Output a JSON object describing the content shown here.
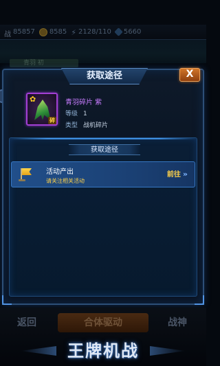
{
  "hud": {
    "power_value": "85857",
    "gold_value": "8585",
    "energy_value": "2128/110",
    "gems_value": "5660"
  },
  "bg_tab_label": "青羽 初",
  "dialog": {
    "title": "获取途径",
    "close_label": "X",
    "item": {
      "name": "青羽碎片 紫",
      "level_key": "等级",
      "level_value": "1",
      "type_key": "类型",
      "type_value": "战机碎片",
      "rarity_color": "#a23fd4"
    },
    "section_label": "获取途径",
    "sources": [
      {
        "title": "活动产出",
        "subtitle": "请关注相关活动",
        "goto_label": "前往",
        "icon": "flag-icon"
      }
    ]
  },
  "bottom_bar": {
    "back_label": "返回",
    "merge_label": "合体驱动",
    "warlord_label": "战神"
  },
  "logo_text": "王牌机战"
}
